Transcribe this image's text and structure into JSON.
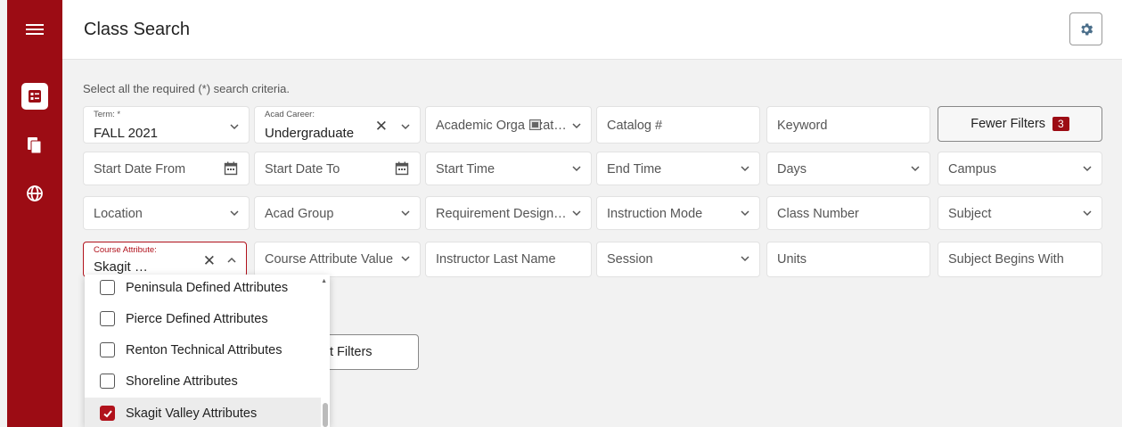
{
  "page": {
    "title": "Class Search",
    "hint": "Select all the required (*) search criteria."
  },
  "colors": {
    "brand": "#9c0c14",
    "accent": "#b1121c"
  },
  "sidebar": {
    "items": [
      "menu-icon",
      "class-search-icon",
      "copy-icon",
      "globe-icon"
    ]
  },
  "filters": {
    "term": {
      "label": "Term: *",
      "value": "FALL 2021"
    },
    "acad_career": {
      "label": "Acad Career:",
      "value": "Undergraduate"
    },
    "academic_org": {
      "placeholder": "Academic Orga",
      "placeholder_tail": "zat…"
    },
    "catalog": {
      "placeholder": "Catalog #"
    },
    "keyword": {
      "placeholder": "Keyword"
    },
    "start_date_from": {
      "placeholder": "Start Date From"
    },
    "start_date_to": {
      "placeholder": "Start Date To"
    },
    "start_time": {
      "placeholder": "Start Time"
    },
    "end_time": {
      "placeholder": "End Time"
    },
    "days": {
      "placeholder": "Days"
    },
    "campus": {
      "placeholder": "Campus"
    },
    "location": {
      "placeholder": "Location"
    },
    "acad_group": {
      "placeholder": "Acad Group"
    },
    "requirement": {
      "placeholder": "Requirement Design…"
    },
    "instruction_mode": {
      "placeholder": "Instruction Mode"
    },
    "class_number": {
      "placeholder": "Class Number"
    },
    "subject": {
      "placeholder": "Subject"
    },
    "course_attribute": {
      "label": "Course Attribute:",
      "value": "Skagit …"
    },
    "course_attribute_value": {
      "placeholder": "Course Attribute Value"
    },
    "instructor": {
      "placeholder": "Instructor Last Name"
    },
    "session": {
      "placeholder": "Session"
    },
    "units": {
      "placeholder": "Units"
    },
    "subject_begins": {
      "placeholder": "Subject Begins With"
    }
  },
  "fewer_filters": {
    "label": "Fewer Filters",
    "count": "3"
  },
  "behind_button": {
    "label": "t Filters"
  },
  "dropdown": {
    "items": [
      {
        "label": "Peninsula Defined Attributes",
        "checked": false
      },
      {
        "label": "Pierce Defined Attributes",
        "checked": false
      },
      {
        "label": "Renton Technical Attributes",
        "checked": false
      },
      {
        "label": "Shoreline Attributes",
        "checked": false
      },
      {
        "label": "Skagit Valley Attributes",
        "checked": true
      }
    ]
  }
}
